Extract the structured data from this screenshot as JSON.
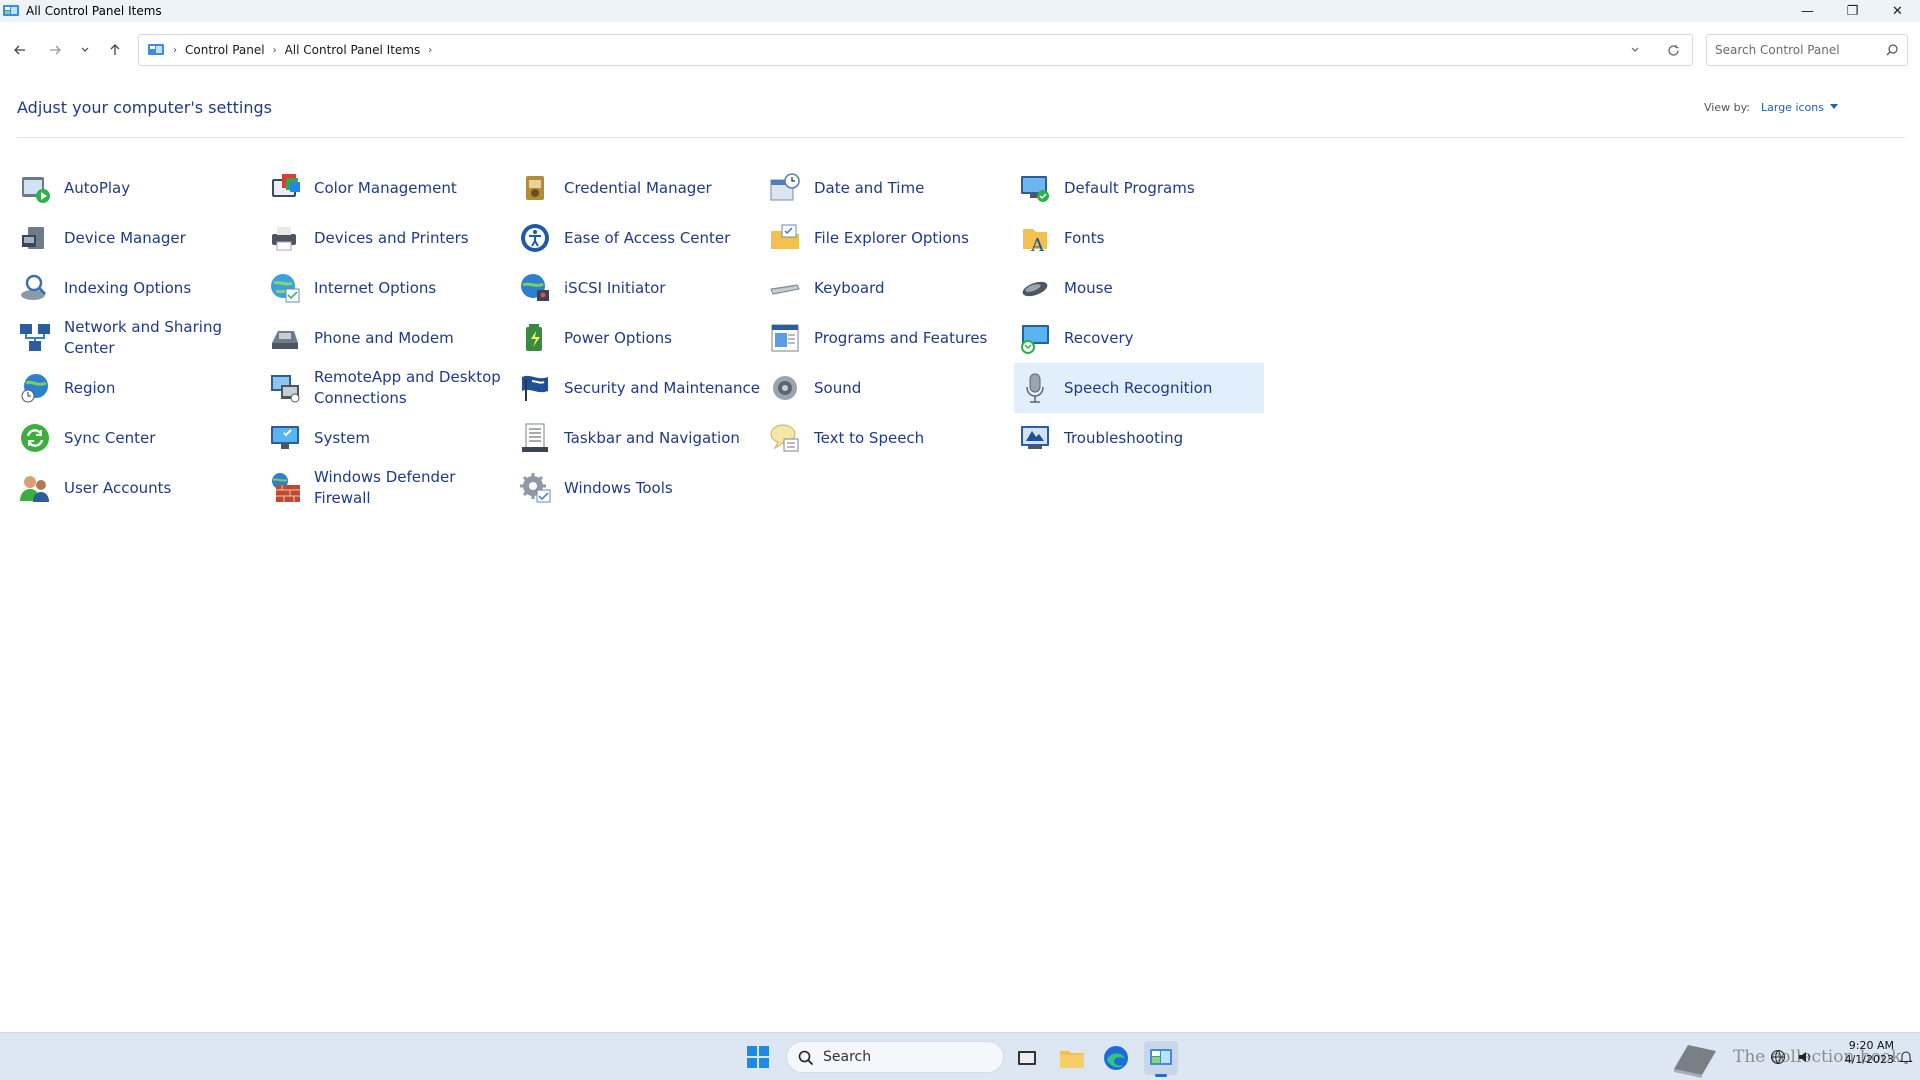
{
  "window": {
    "title": "All Control Panel Items",
    "controls": {
      "minimize": "—",
      "maximize": "❐",
      "close": "✕"
    }
  },
  "address": {
    "crumbs": [
      "Control Panel",
      "All Control Panel Items"
    ],
    "search_placeholder": "Search Control Panel"
  },
  "main": {
    "heading": "Adjust your computer's settings",
    "view_by_label": "View by:",
    "view_by_value": "Large icons"
  },
  "items": [
    {
      "label": "AutoPlay",
      "icon": "autoplay-icon"
    },
    {
      "label": "Color Management",
      "icon": "color-management-icon"
    },
    {
      "label": "Credential Manager",
      "icon": "credential-manager-icon"
    },
    {
      "label": "Date and Time",
      "icon": "date-time-icon"
    },
    {
      "label": "Default Programs",
      "icon": "default-programs-icon"
    },
    {
      "label": "Device Manager",
      "icon": "device-manager-icon"
    },
    {
      "label": "Devices and Printers",
      "icon": "printer-icon"
    },
    {
      "label": "Ease of Access Center",
      "icon": "ease-of-access-icon"
    },
    {
      "label": "File Explorer Options",
      "icon": "folder-options-icon"
    },
    {
      "label": "Fonts",
      "icon": "fonts-icon"
    },
    {
      "label": "Indexing Options",
      "icon": "indexing-icon"
    },
    {
      "label": "Internet Options",
      "icon": "internet-options-icon"
    },
    {
      "label": "iSCSI Initiator",
      "icon": "iscsi-icon"
    },
    {
      "label": "Keyboard",
      "icon": "keyboard-icon"
    },
    {
      "label": "Mouse",
      "icon": "mouse-icon"
    },
    {
      "label": "Network and Sharing Center",
      "icon": "network-icon"
    },
    {
      "label": "Phone and Modem",
      "icon": "phone-modem-icon"
    },
    {
      "label": "Power Options",
      "icon": "power-options-icon"
    },
    {
      "label": "Programs and Features",
      "icon": "programs-features-icon"
    },
    {
      "label": "Recovery",
      "icon": "recovery-icon"
    },
    {
      "label": "Region",
      "icon": "region-icon"
    },
    {
      "label": "RemoteApp and Desktop Connections",
      "icon": "remoteapp-icon"
    },
    {
      "label": "Security and Maintenance",
      "icon": "security-flag-icon"
    },
    {
      "label": "Sound",
      "icon": "speaker-icon"
    },
    {
      "label": "Speech Recognition",
      "icon": "microphone-icon",
      "selected": true
    },
    {
      "label": "Sync Center",
      "icon": "sync-icon"
    },
    {
      "label": "System",
      "icon": "system-icon"
    },
    {
      "label": "Taskbar and Navigation",
      "icon": "taskbar-icon"
    },
    {
      "label": "Text to Speech",
      "icon": "text-to-speech-icon"
    },
    {
      "label": "Troubleshooting",
      "icon": "troubleshooting-icon"
    },
    {
      "label": "User Accounts",
      "icon": "user-accounts-icon"
    },
    {
      "label": "Windows Defender Firewall",
      "icon": "firewall-icon"
    },
    {
      "label": "Windows Tools",
      "icon": "windows-tools-icon"
    }
  ],
  "taskbar": {
    "search_label": "Search",
    "watermark_text": "The collection book",
    "time": "9:20 AM",
    "date": "4/1/2023"
  },
  "colors": {
    "link": "#1e3a8a",
    "selected_bg": "#e1eefb",
    "accent": "#1c6ed6"
  }
}
